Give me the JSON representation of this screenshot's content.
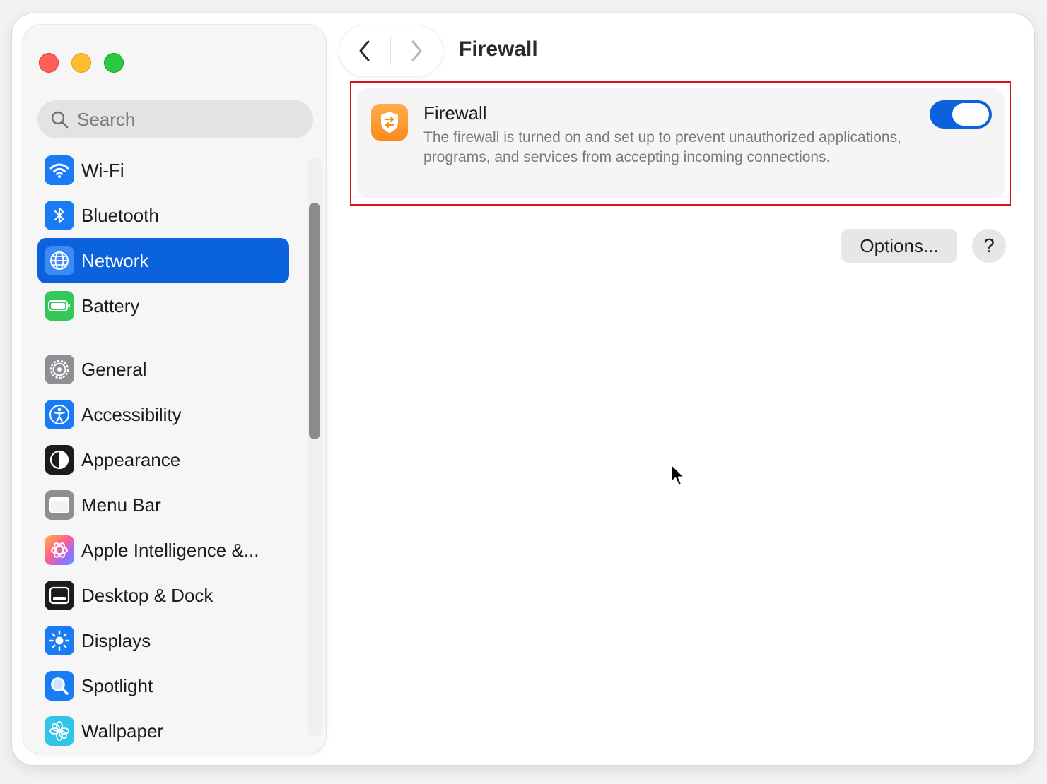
{
  "window": {
    "title": "Firewall"
  },
  "sidebar": {
    "search_placeholder": "Search",
    "items": [
      {
        "label": "Wi-Fi",
        "icon": "wifi-icon",
        "color": "#1a7cf5"
      },
      {
        "label": "Bluetooth",
        "icon": "bluetooth-icon",
        "color": "#1a7cf5"
      },
      {
        "label": "Network",
        "icon": "globe-icon",
        "color": "#1a7cf5",
        "selected": true
      },
      {
        "label": "Battery",
        "icon": "battery-icon",
        "color": "#34c759"
      },
      {
        "label": "General",
        "icon": "gear-icon",
        "color": "#8e8e93"
      },
      {
        "label": "Accessibility",
        "icon": "accessibility-icon",
        "color": "#1a7cf5"
      },
      {
        "label": "Appearance",
        "icon": "appearance-icon",
        "color": "#1c1c1e"
      },
      {
        "label": "Menu Bar",
        "icon": "menubar-icon",
        "color": "#8e8e93"
      },
      {
        "label": "Apple Intelligence &...",
        "icon": "apple-intelligence-icon",
        "color": "#ff6fa3"
      },
      {
        "label": "Desktop & Dock",
        "icon": "dock-icon",
        "color": "#1c1c1e"
      },
      {
        "label": "Displays",
        "icon": "displays-icon",
        "color": "#1a7cf5"
      },
      {
        "label": "Spotlight",
        "icon": "spotlight-icon",
        "color": "#1a7cf5"
      },
      {
        "label": "Wallpaper",
        "icon": "wallpaper-icon",
        "color": "#33c5e8"
      }
    ]
  },
  "firewall": {
    "title": "Firewall",
    "description": "The firewall is turned on and set up to prevent unauthorized applications, programs, and services from accepting incoming connections.",
    "enabled": true
  },
  "buttons": {
    "options": "Options...",
    "help": "?"
  },
  "colors": {
    "accent": "#0a63dc",
    "highlight": "#d9141b",
    "firewall_icon": "#fb8b1e"
  }
}
